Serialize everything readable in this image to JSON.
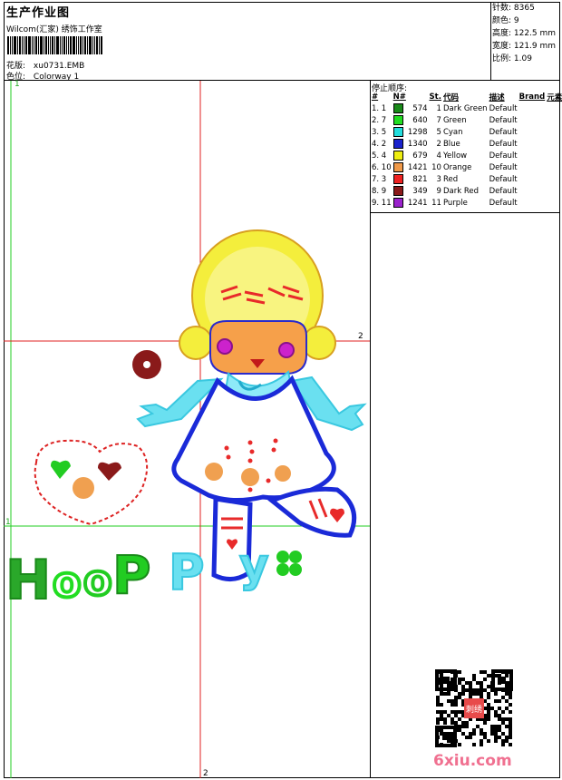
{
  "header": {
    "title": "生产作业图",
    "subtitle": "Wilcom(汇家) 绣饰工作室",
    "design_label": "花版:",
    "design_value": "xu0731.EMB",
    "colorway_label": "色位:",
    "colorway_value": "Colorway 1"
  },
  "stats": {
    "stitches": "针数: 8365",
    "colors": "颜色: 9",
    "height": "高度: 122.5 mm",
    "width": "宽度: 121.9 mm",
    "ratio": "比例: 1.09"
  },
  "stop_sequence": {
    "title": "停止顺序:",
    "headers": [
      "#",
      "N#",
      "St.",
      "代码",
      "描述",
      "Brand",
      "元素"
    ],
    "rows": [
      {
        "idx": "1. 1",
        "color": "#1a8a1a",
        "st": "574",
        "code": "1",
        "desc": "Dark Green",
        "brand": "Default"
      },
      {
        "idx": "2. 7",
        "color": "#22dd22",
        "st": "640",
        "code": "7",
        "desc": "Green",
        "brand": "Default"
      },
      {
        "idx": "3. 5",
        "color": "#22dddd",
        "st": "1298",
        "code": "5",
        "desc": "Cyan",
        "brand": "Default"
      },
      {
        "idx": "4. 2",
        "color": "#1a22cc",
        "st": "1340",
        "code": "2",
        "desc": "Blue",
        "brand": "Default"
      },
      {
        "idx": "5. 4",
        "color": "#eeee11",
        "st": "679",
        "code": "4",
        "desc": "Yellow",
        "brand": "Default"
      },
      {
        "idx": "6. 10",
        "color": "#f09a4a",
        "st": "1421",
        "code": "10",
        "desc": "Orange",
        "brand": "Default"
      },
      {
        "idx": "7. 3",
        "color": "#ee2222",
        "st": "821",
        "code": "3",
        "desc": "Red",
        "brand": "Default"
      },
      {
        "idx": "8. 9",
        "color": "#8a1a1a",
        "st": "349",
        "code": "9",
        "desc": "Dark Red",
        "brand": "Default"
      },
      {
        "idx": "9. 11",
        "color": "#9a22cc",
        "st": "1241",
        "code": "11",
        "desc": "Purple",
        "brand": "Default"
      }
    ]
  },
  "guides": {
    "one_top": "1",
    "one_left": "1",
    "two_right": "2",
    "two_bottom": "2"
  },
  "watermark": "6xiu.com",
  "qr_stamp": "刺绣"
}
